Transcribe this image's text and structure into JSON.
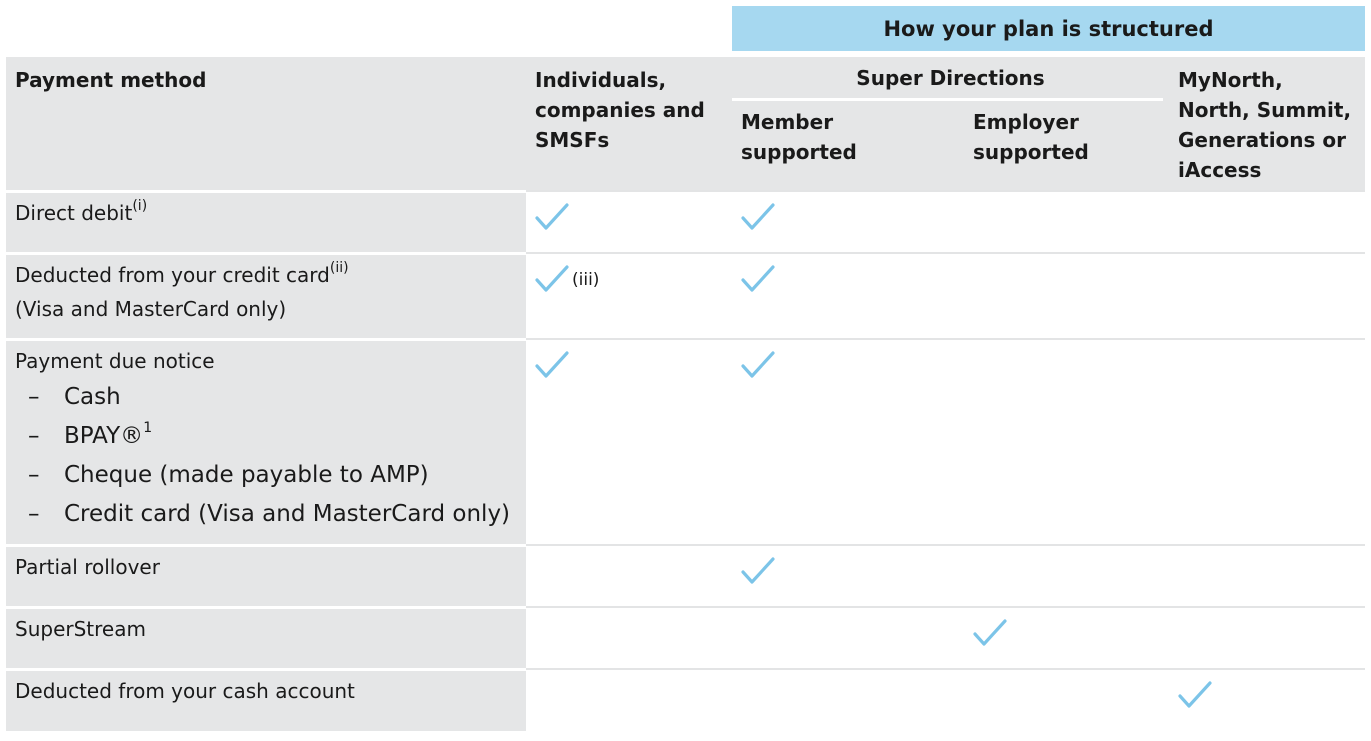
{
  "header": {
    "top_title": "How your plan is structured",
    "col_payment": "Payment method",
    "col_individuals": "Individuals, companies and SMSFs",
    "col_super_directions": "Super Directions",
    "col_member_supported": "Member supported",
    "col_employer_supported": "Employer supported",
    "col_mynorth": "MyNorth, North, Summit, Generations or iAccess"
  },
  "colors": {
    "accent": "#a6d8f0",
    "label_bg": "#e5e6e7",
    "check": "#7cc4e8"
  },
  "icons": {
    "tick": "check-icon"
  },
  "rows": [
    {
      "label": "Direct debit",
      "sup": "(i)",
      "checks": [
        true,
        true,
        false,
        false
      ],
      "note": ""
    },
    {
      "label": "Deducted from your credit card",
      "sup": "(ii)",
      "label_line2": "(Visa and MasterCard only)",
      "checks": [
        true,
        true,
        false,
        false
      ],
      "note": "(iii)"
    },
    {
      "label": "Payment due notice",
      "sub_items": [
        "Cash",
        "BPAY®",
        "Cheque (made payable to AMP)",
        "Credit card (Visa and MasterCard only)"
      ],
      "bpay_sup": "1",
      "dash": "–",
      "checks": [
        true,
        true,
        false,
        false
      ]
    },
    {
      "label": "Partial rollover",
      "checks": [
        false,
        true,
        false,
        false
      ]
    },
    {
      "label": "SuperStream",
      "checks": [
        false,
        false,
        true,
        false
      ]
    },
    {
      "label": "Deducted from your cash account",
      "checks": [
        false,
        false,
        false,
        true
      ]
    }
  ]
}
